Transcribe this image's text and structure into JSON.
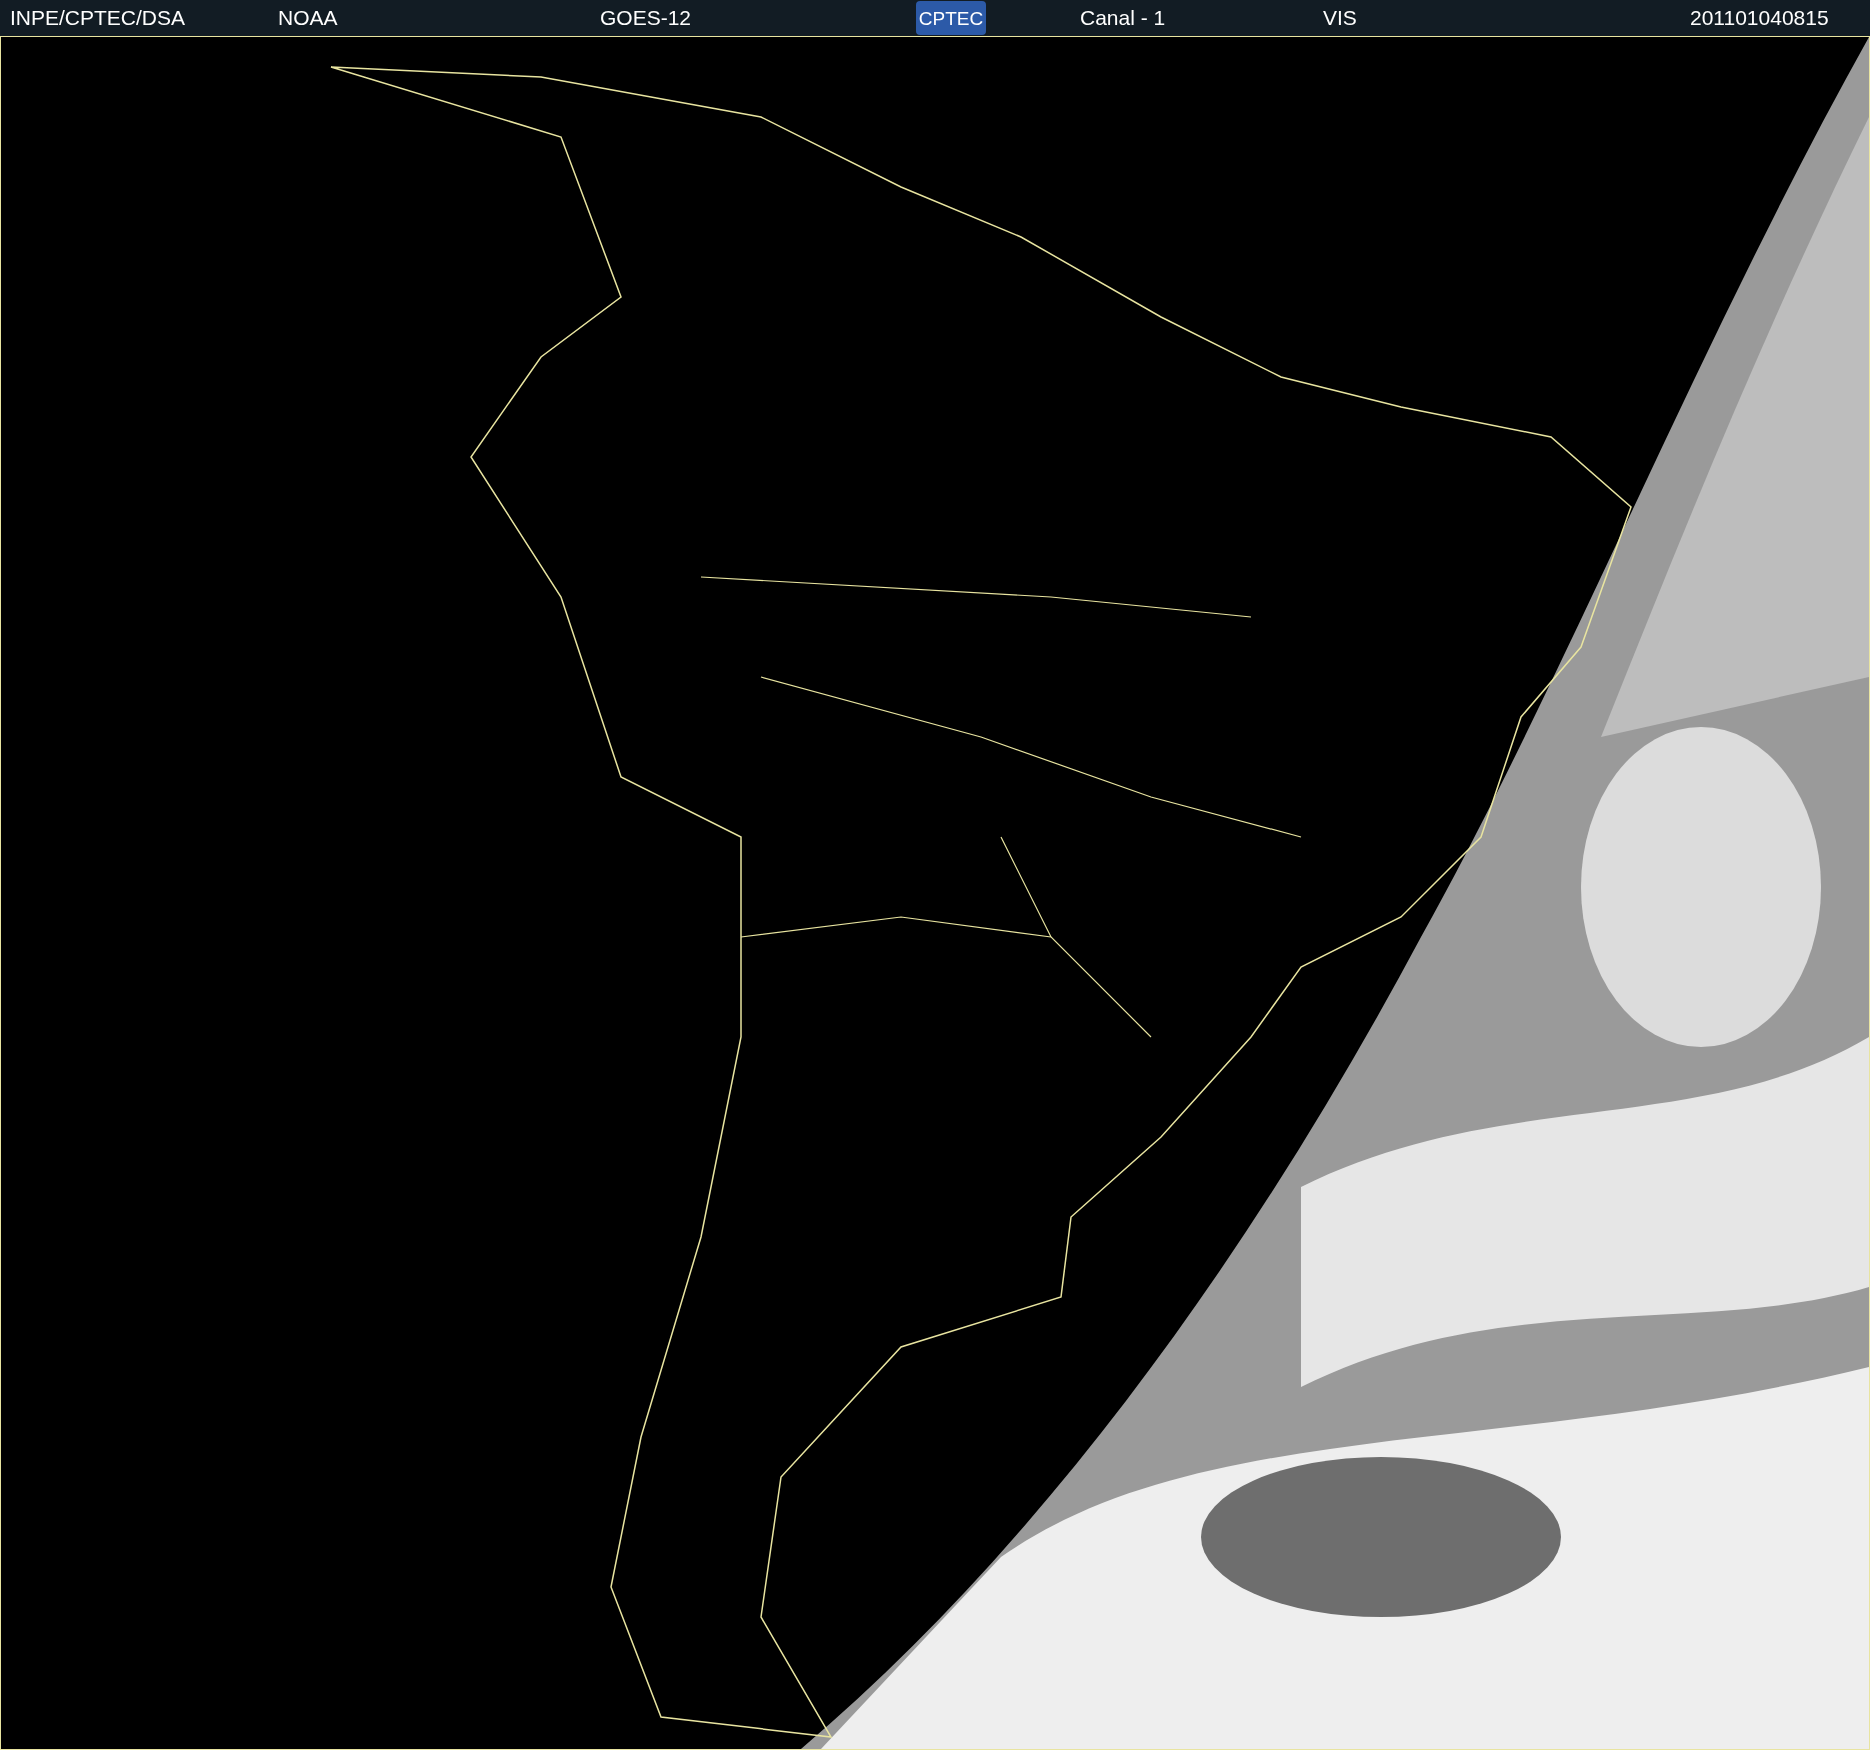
{
  "header": {
    "items": [
      {
        "kind": "text",
        "text": "INPE/CPTEC/DSA"
      },
      {
        "kind": "text",
        "text": "NOAA"
      },
      {
        "kind": "text",
        "text": "GOES-12"
      },
      {
        "kind": "logo",
        "text": "CPTEC"
      },
      {
        "kind": "text",
        "text": "Canal - 1"
      },
      {
        "kind": "text",
        "text": "VIS"
      },
      {
        "kind": "text",
        "text": "201101040815"
      }
    ]
  }
}
